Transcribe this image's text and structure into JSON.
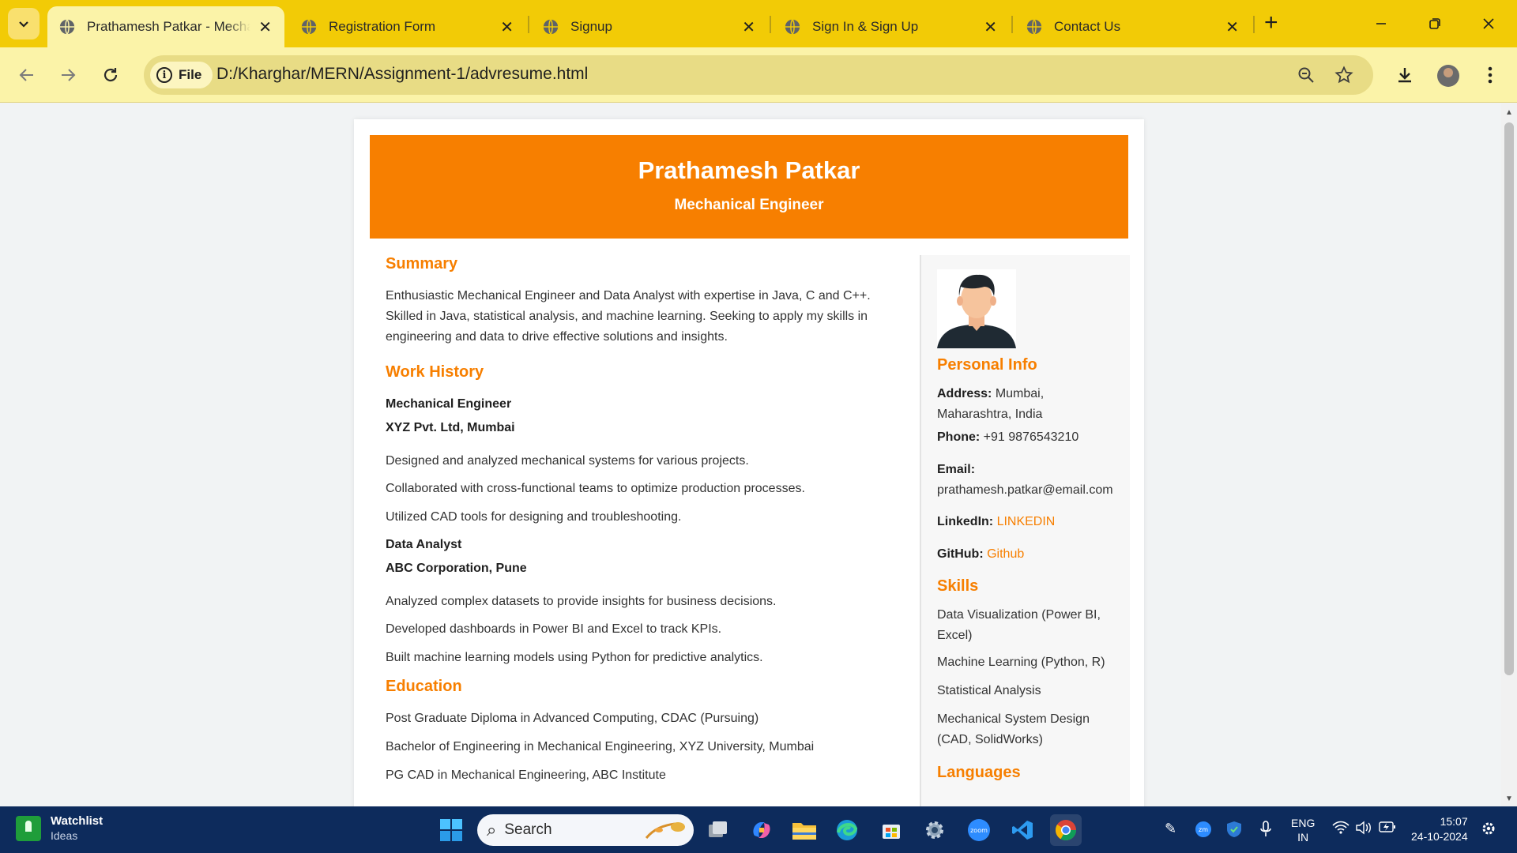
{
  "browser": {
    "tabs": [
      {
        "title": "Prathamesh Patkar - Mecha",
        "active": true
      },
      {
        "title": "Registration Form",
        "active": false
      },
      {
        "title": "Signup",
        "active": false
      },
      {
        "title": "Sign In & Sign Up",
        "active": false
      },
      {
        "title": "Contact Us",
        "active": false
      }
    ],
    "address_chip": "File",
    "url": "D:/Kharghar/MERN/Assignment-1/advresume.html"
  },
  "resume": {
    "name": "Prathamesh Patkar",
    "role": "Mechanical Engineer",
    "summary_title": "Summary",
    "summary_text": "Enthusiastic Mechanical Engineer and Data Analyst with expertise in Java, C and C++. Skilled in Java, statistical analysis, and machine learning. Seeking to apply my skills in engineering and data to drive effective solutions and insights.",
    "work_title": "Work History",
    "jobs": [
      {
        "title": "Mechanical Engineer",
        "company": "XYZ Pvt. Ltd, Mumbai",
        "points": [
          "Designed and analyzed mechanical systems for various projects.",
          "Collaborated with cross-functional teams to optimize production processes.",
          "Utilized CAD tools for designing and troubleshooting."
        ]
      },
      {
        "title": "Data Analyst",
        "company": "ABC Corporation, Pune",
        "points": [
          "Analyzed complex datasets to provide insights for business decisions.",
          "Developed dashboards in Power BI and Excel to track KPIs.",
          "Built machine learning models using Python for predictive analytics."
        ]
      }
    ],
    "education_title": "Education",
    "education": [
      "Post Graduate Diploma in Advanced Computing, CDAC (Pursuing)",
      "Bachelor of Engineering in Mechanical Engineering, XYZ University, Mumbai",
      "PG CAD in Mechanical Engineering, ABC Institute"
    ],
    "personal_title": "Personal Info",
    "personal": {
      "address_label": "Address:",
      "address_value": "Mumbai, Maharashtra, India",
      "phone_label": "Phone:",
      "phone_value": "+91 9876543210",
      "email_label": "Email:",
      "email_value": "prathamesh.patkar@email.com",
      "linkedin_label": "LinkedIn:",
      "linkedin_value": "LINKEDIN",
      "github_label": "GitHub:",
      "github_value": "Github"
    },
    "skills_title": "Skills",
    "skills": [
      "Data Visualization (Power BI, Excel)",
      "Machine Learning (Python, R)",
      "Statistical Analysis",
      "Mechanical System Design (CAD, SolidWorks)"
    ],
    "languages_title": "Languages",
    "accent_color": "#f77f00"
  },
  "taskbar": {
    "widget_title": "Watchlist",
    "widget_subtitle": "Ideas",
    "search_placeholder": "Search",
    "lang_line1": "ENG",
    "lang_line2": "IN",
    "time": "15:07",
    "date": "24-10-2024"
  }
}
